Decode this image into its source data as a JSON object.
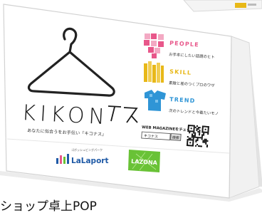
{
  "brand": {
    "logo": "KIKONAS",
    "tagline": "あなたに似合うをお手伝い「キコナス」"
  },
  "sections": [
    {
      "title": "PEOPLE",
      "text": "お手本にしたい話題のヒト",
      "color": "#e8578a",
      "icon": "pixel-heart-icon"
    },
    {
      "title": "SKILL",
      "text": "素敵と差のつくプロのワザ",
      "color": "#e8b818",
      "icon": "pencils-icon"
    },
    {
      "title": "TREND",
      "text": "次のトレンドと今着たいモノ",
      "color": "#2f95d6",
      "icon": "tshirt-icon"
    }
  ],
  "web": {
    "heading": "WEB MAGAZINEをチェック",
    "search_value": "キコナス",
    "search_button": "検索"
  },
  "logos": {
    "lalaport_small": "ゴボッシュビングパーク",
    "lalaport": "LaLaport",
    "lazona": "LAZONA"
  },
  "caption": "ショップ卓上POP",
  "colors": {
    "background": "#ffffff",
    "lazona_green": "#69c236",
    "lalaport_blue": "#1f5aa6"
  }
}
